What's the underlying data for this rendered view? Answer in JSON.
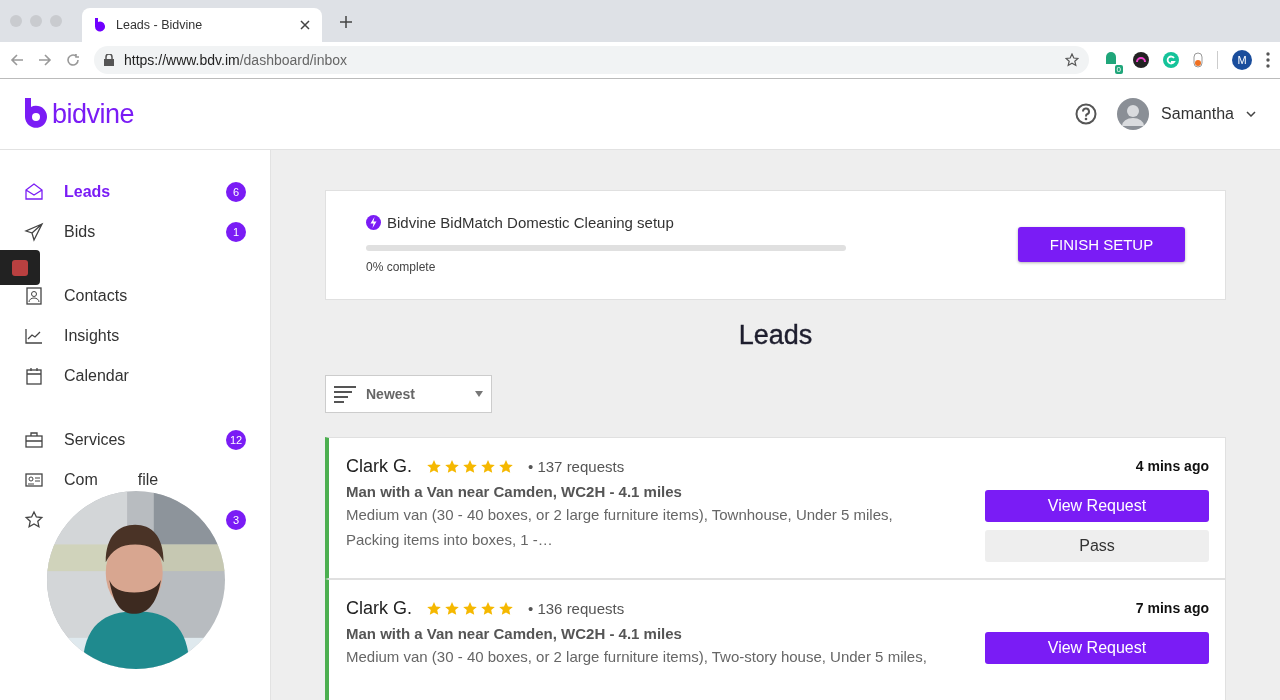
{
  "browser": {
    "tab_title": "Leads - Bidvine",
    "url_host": "https://www.bdv.im",
    "url_path": "/dashboard/inbox",
    "profile_initial": "M",
    "extension_badge": "0"
  },
  "header": {
    "logo_text": "bidvine",
    "user_name": "Samantha"
  },
  "sidebar": {
    "groups": [
      {
        "items": [
          {
            "label": "Leads",
            "badge": "6",
            "selected": true
          },
          {
            "label": "Bids",
            "badge": "1",
            "selected": false
          }
        ]
      },
      {
        "items": [
          {
            "label": "Contacts",
            "selected": false
          },
          {
            "label": "Insights",
            "selected": false
          },
          {
            "label": "Calendar",
            "selected": false
          }
        ]
      },
      {
        "items": [
          {
            "label": "Services",
            "badge": "12",
            "selected": false
          },
          {
            "label": "Com",
            "label_tail": "file",
            "selected": false
          },
          {
            "badge": "3",
            "selected": false
          }
        ]
      }
    ]
  },
  "setup": {
    "title": "Bidvine BidMatch Domestic Cleaning setup",
    "level": 0,
    "progress_text": "0% complete",
    "button": "FINISH SETUP"
  },
  "page_title": "Leads",
  "sort": {
    "value": "Newest"
  },
  "leads": [
    {
      "name": "Clark G.",
      "stars": 5,
      "requests": "• 137 requests",
      "title": "Man with a Van near Camden, WC2H - 4.1 miles",
      "description": "Medium van (30 - 40 boxes, or 2 large furniture items), Townhouse, Under 5 miles, Packing items into boxes, 1 -…",
      "time": "4 mins ago",
      "view_button": "View Request",
      "pass_button": "Pass"
    },
    {
      "name": "Clark G.",
      "stars": 5,
      "requests": "• 136 requests",
      "title": "Man with a Van near Camden, WC2H - 4.1 miles",
      "description": "Medium van (30 - 40 boxes, or 2 large furniture items), Two-story house, Under 5 miles,",
      "time": "7 mins ago",
      "view_button": "View Request"
    }
  ]
}
